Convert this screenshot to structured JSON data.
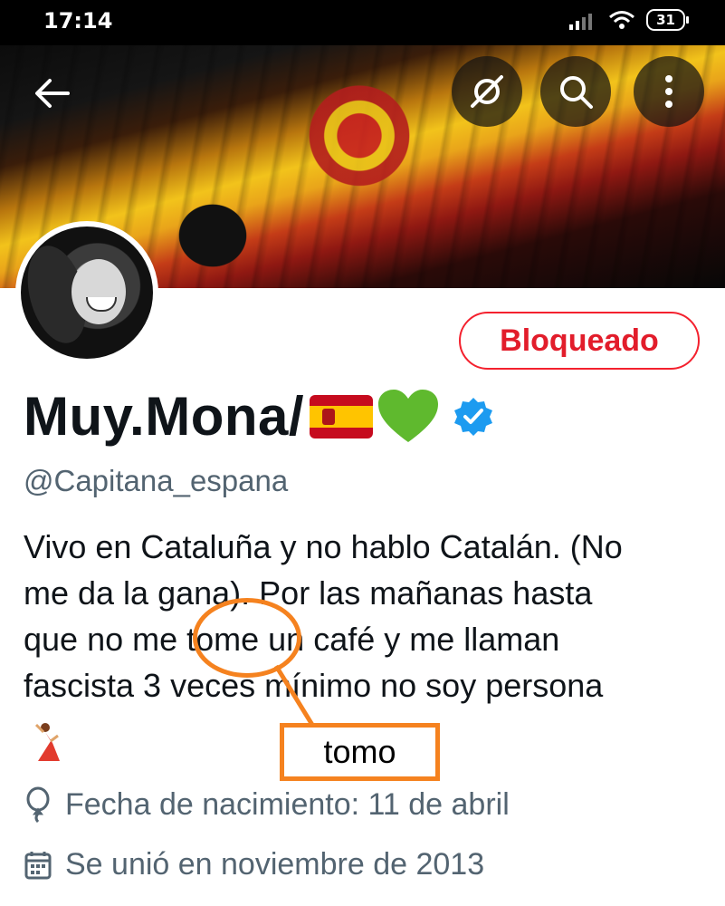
{
  "status_bar": {
    "time": "17:14",
    "battery": "31"
  },
  "profile": {
    "display_name": "Muy.Mona/",
    "handle": "@Capitana_espana",
    "blocked_label": "Bloqueado",
    "bio_lines": [
      "Vivo en Cataluña y no hablo Catalán. (No",
      "me da la gana). Por las mañanas hasta",
      "que no me tome un café y me llaman",
      "fascista 3 veces mínimo no soy persona"
    ],
    "birthday": "Fecha de nacimiento: 11 de abril",
    "joined": "Se unió en noviembre de 2013"
  },
  "annotation": {
    "correction": "tomo",
    "color": "#f5821f"
  },
  "colors": {
    "blocked_red": "#f4212e",
    "verified_blue": "#1d9bf0",
    "secondary_text": "#536471"
  },
  "icons": [
    "back-arrow-icon",
    "unfollow-icon",
    "search-icon",
    "more-icon",
    "verified-badge-icon",
    "balloon-icon",
    "calendar-icon",
    "flag-spain-icon",
    "green-heart-icon",
    "dancer-icon"
  ]
}
